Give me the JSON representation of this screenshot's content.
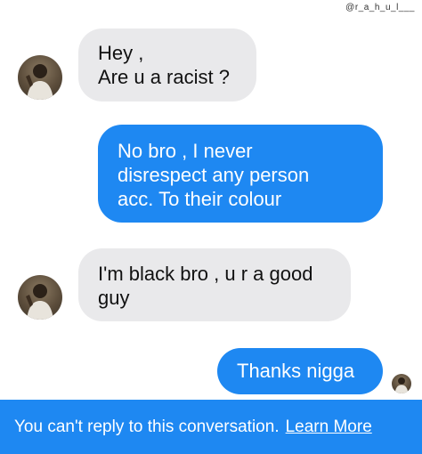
{
  "watermark": "@r_a_h_u_l___",
  "messages": [
    {
      "direction": "incoming",
      "text": "Hey ,\nAre u a racist ?"
    },
    {
      "direction": "outgoing",
      "text": "No bro , I never\ndisrespect any person\nacc. To their colour"
    },
    {
      "direction": "incoming",
      "text": "I'm black bro , u r a good\nguy"
    },
    {
      "direction": "outgoing",
      "text": "Thanks nigga"
    }
  ],
  "footer": {
    "notice": "You can't reply to this conversation.",
    "link": "Learn More"
  },
  "colors": {
    "outgoing_bubble": "#1e88f2",
    "incoming_bubble": "#e9e9eb",
    "footer_bar": "#1e88f2"
  },
  "icons": {
    "contact_avatar": "person-photo-avatar",
    "sender_avatar": "person-photo-avatar-small"
  }
}
